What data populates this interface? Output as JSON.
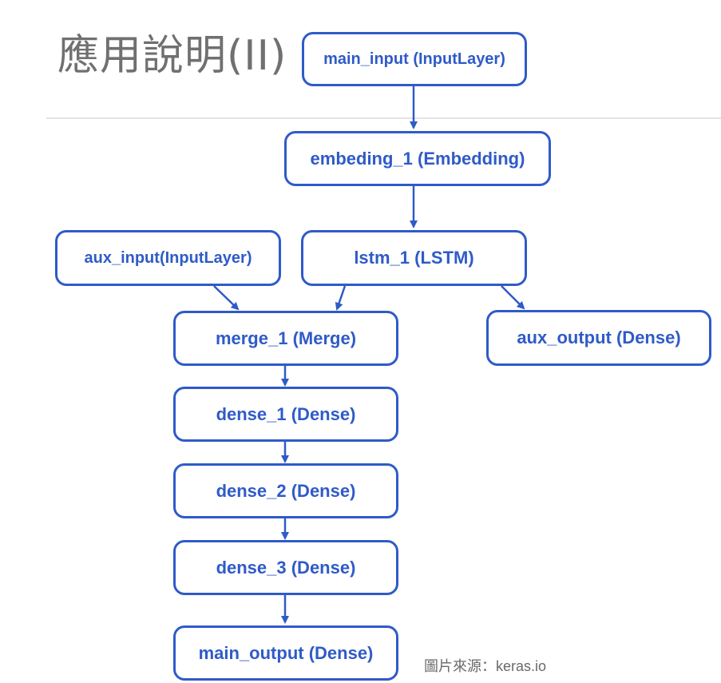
{
  "slide": {
    "title": "應用說明(II)",
    "source_text": "圖片來源：keras.io"
  },
  "diagram": {
    "line_color": "#2f5bc8",
    "nodes": {
      "main_input": "main_input (InputLayer)",
      "embeding_1": "embeding_1 (Embedding)",
      "aux_input": "aux_input(InputLayer)",
      "lstm_1": "lstm_1 (LSTM)",
      "merge_1": "merge_1 (Merge)",
      "aux_output": "aux_output (Dense)",
      "dense_1": "dense_1 (Dense)",
      "dense_2": "dense_2 (Dense)",
      "dense_3": "dense_3 (Dense)",
      "main_output": "main_output (Dense)"
    },
    "edges": [
      {
        "from": "main_input",
        "to": "embeding_1"
      },
      {
        "from": "embeding_1",
        "to": "lstm_1"
      },
      {
        "from": "aux_input",
        "to": "merge_1"
      },
      {
        "from": "lstm_1",
        "to": "merge_1"
      },
      {
        "from": "lstm_1",
        "to": "aux_output"
      },
      {
        "from": "merge_1",
        "to": "dense_1"
      },
      {
        "from": "dense_1",
        "to": "dense_2"
      },
      {
        "from": "dense_2",
        "to": "dense_3"
      },
      {
        "from": "dense_3",
        "to": "main_output"
      }
    ]
  }
}
